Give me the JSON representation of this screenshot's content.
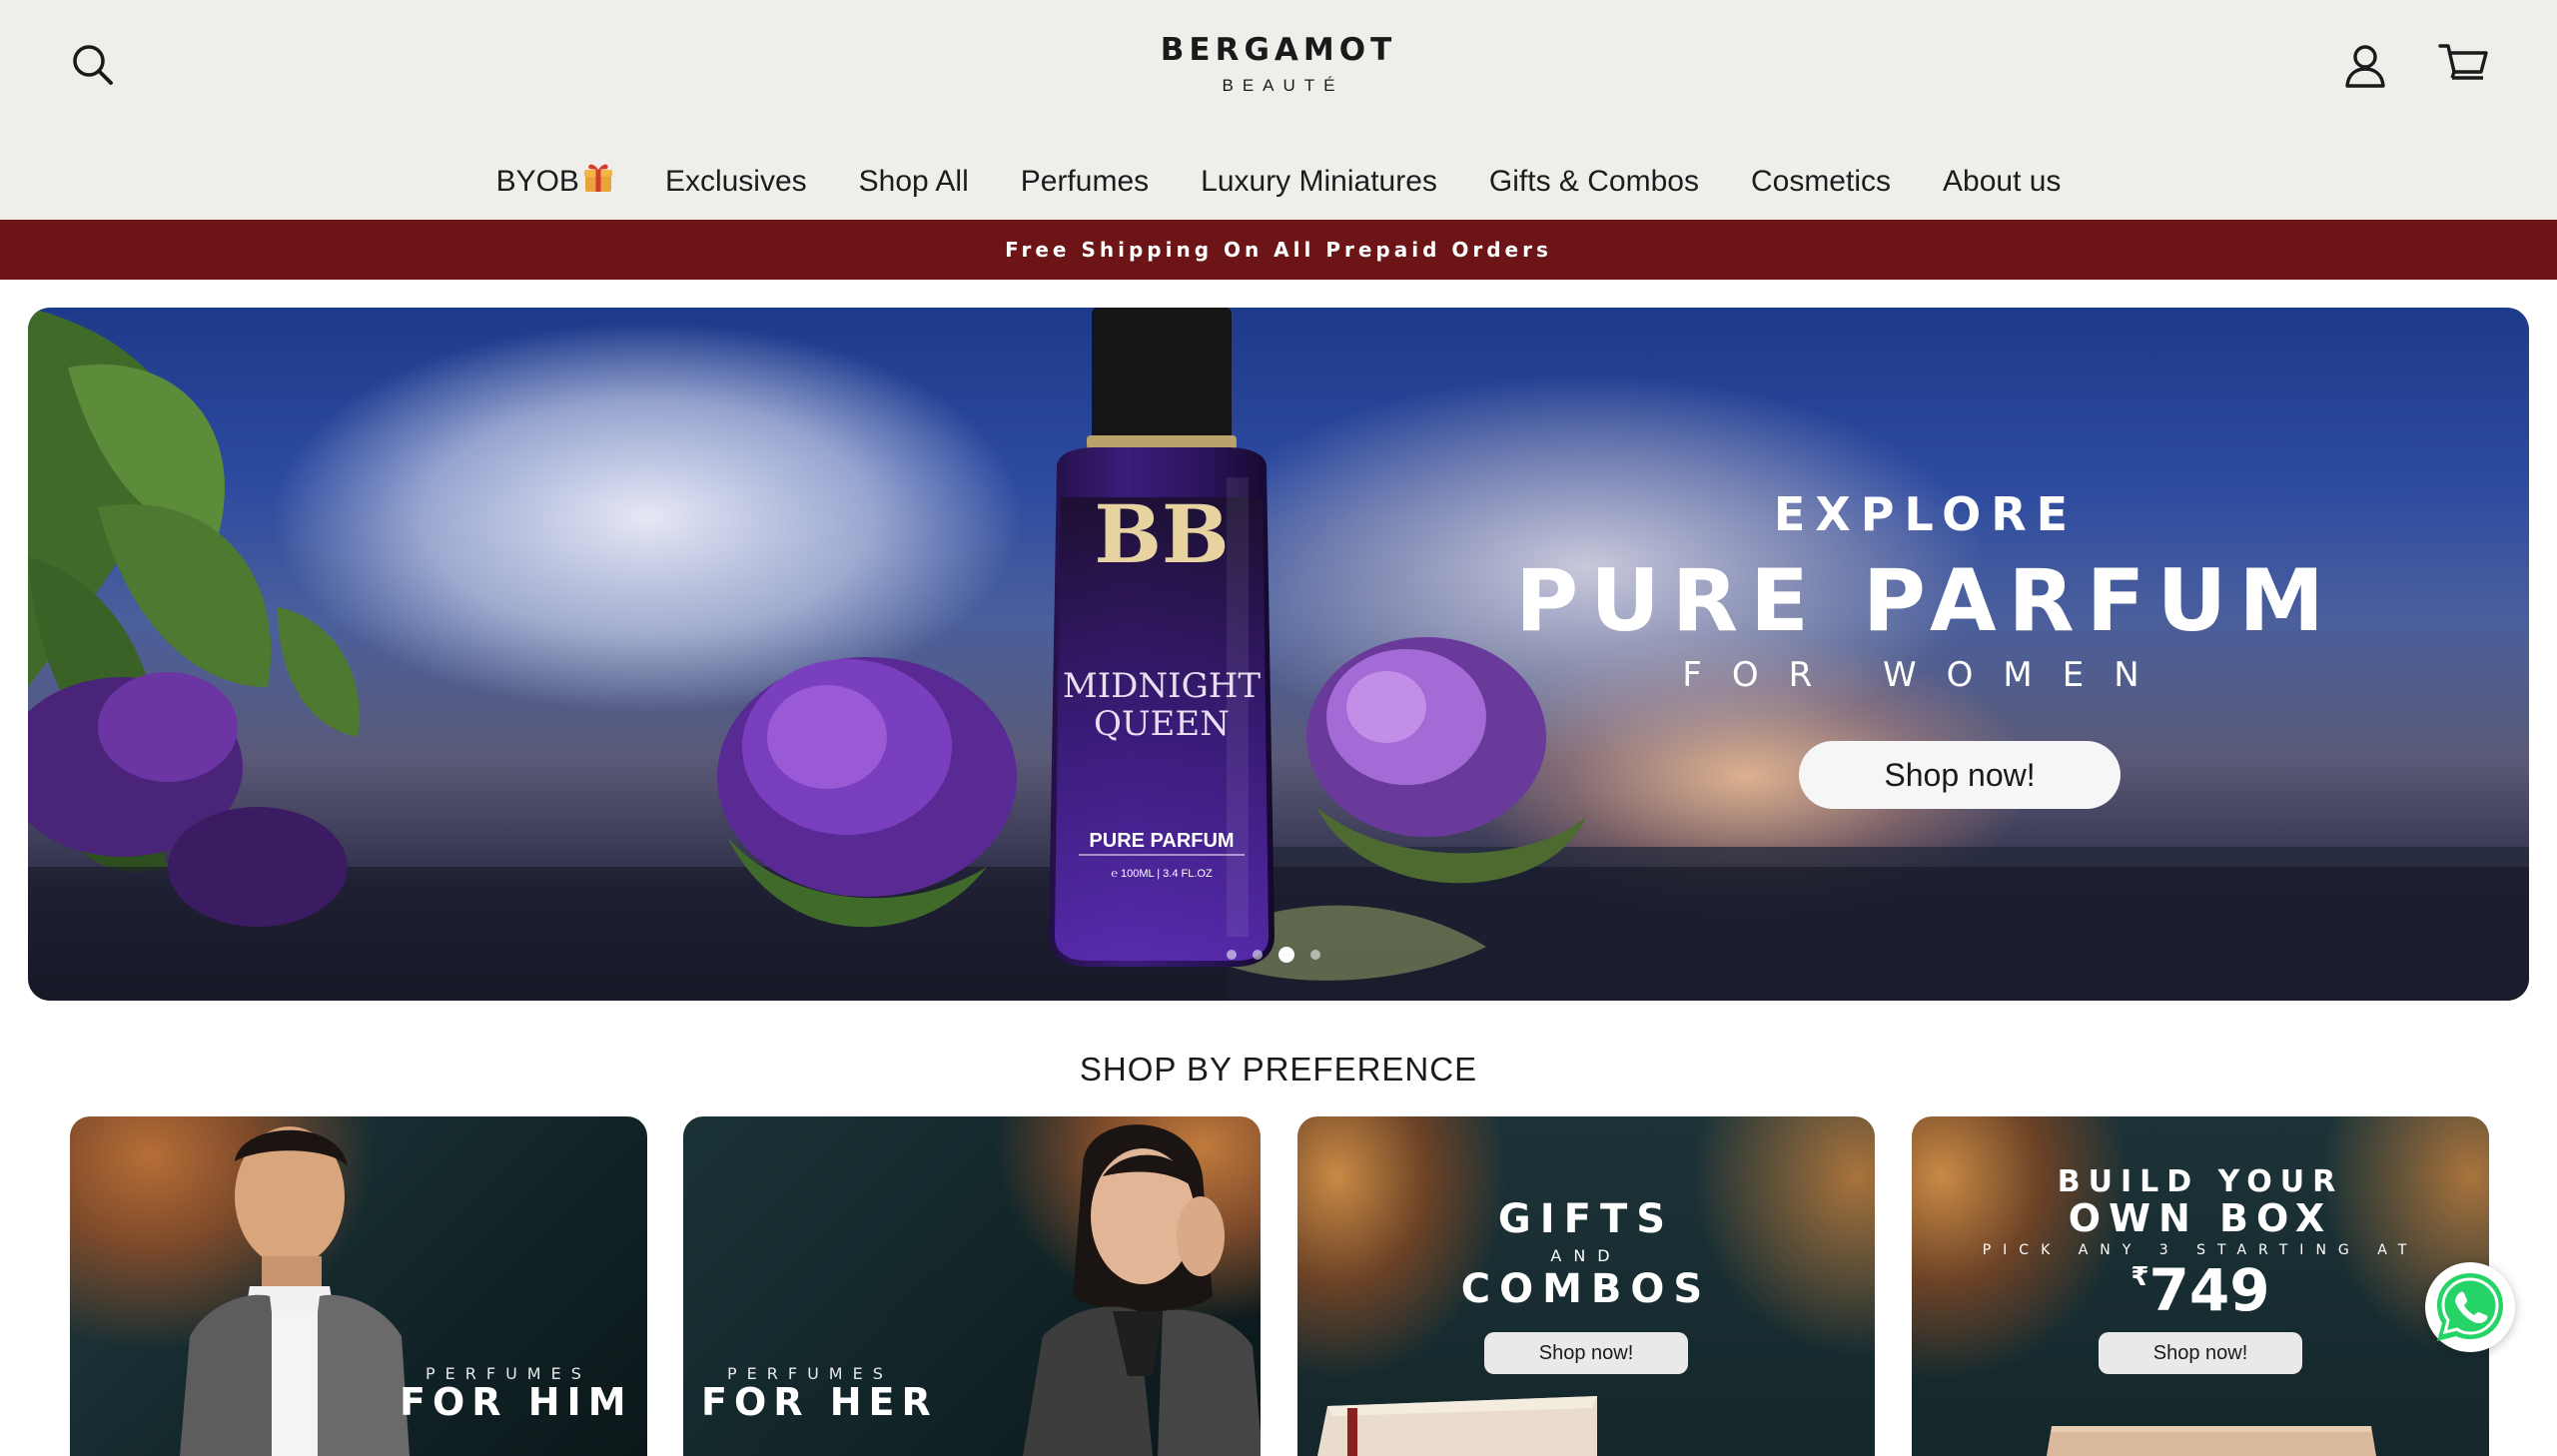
{
  "header": {
    "logo_main": "BERGAMOT",
    "logo_sub": "BEAUTÉ",
    "icons": {
      "search": "search-icon",
      "account": "user-icon",
      "cart": "cart-icon"
    }
  },
  "nav": {
    "items": [
      {
        "label": "BYOB"
      },
      {
        "label": "Exclusives"
      },
      {
        "label": "Shop All"
      },
      {
        "label": "Perfumes"
      },
      {
        "label": "Luxury Miniatures"
      },
      {
        "label": "Gifts & Combos"
      },
      {
        "label": "Cosmetics"
      },
      {
        "label": "About us"
      }
    ]
  },
  "announcement": {
    "text": "Free Shipping On All Prepaid Orders",
    "bg_color": "#6d1516"
  },
  "hero": {
    "kicker": "EXPLORE",
    "title": "PURE PARFUM",
    "subtitle": "FOR WOMEN",
    "button_label": "Shop now!",
    "bottle": {
      "brand_mark": "BB",
      "name_line1": "MIDNIGHT",
      "name_line2": "QUEEN",
      "label": "PURE PARFUM",
      "volume": "℮ 100ML | 3.4 FL.OZ"
    },
    "slide_count": 4,
    "active_slide": 3
  },
  "section": {
    "title": "SHOP BY PREFERENCE",
    "cards": [
      {
        "kicker": "PERFUMES",
        "title": "FOR HIM"
      },
      {
        "kicker": "PERFUMES",
        "title": "FOR HER"
      },
      {
        "line1": "GIFTS",
        "line2": "AND",
        "line3": "COMBOS",
        "button_label": "Shop now!"
      },
      {
        "line1": "BUILD YOUR",
        "line2": "OWN BOX",
        "line3": "PICK ANY 3 STARTING AT",
        "currency": "₹",
        "price": "749",
        "button_label": "Shop now!"
      }
    ]
  },
  "floating": {
    "whatsapp": "whatsapp-icon",
    "whatsapp_color": "#25d366"
  }
}
